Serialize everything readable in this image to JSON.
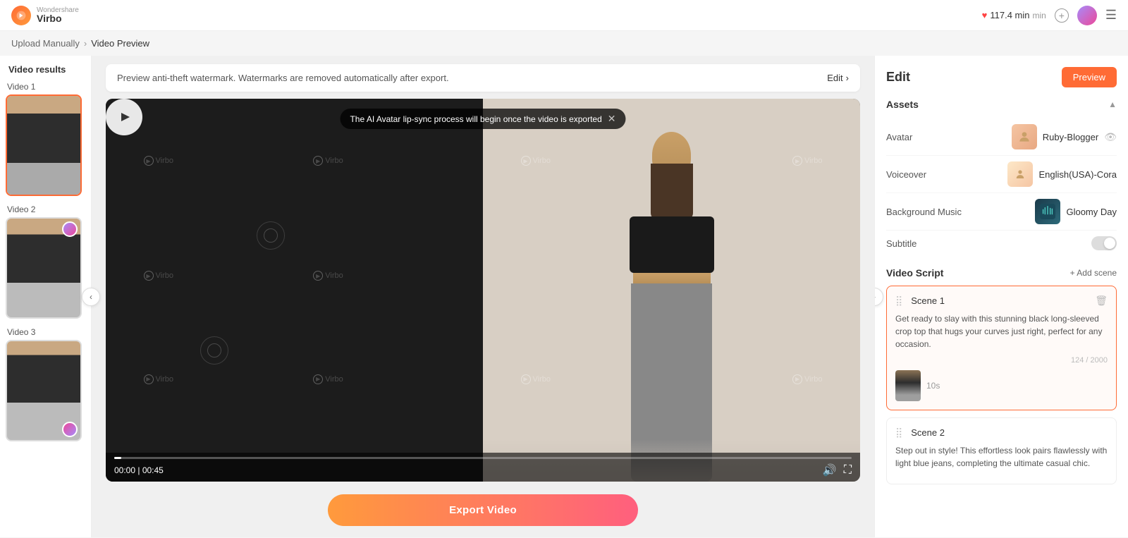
{
  "app": {
    "name": "Wondershare",
    "product": "Virbo",
    "credits": "117.4 min"
  },
  "breadcrumb": {
    "parent": "Upload Manually",
    "current": "Video Preview"
  },
  "sidebar": {
    "title": "Video results",
    "videos": [
      {
        "label": "Video 1",
        "active": true
      },
      {
        "label": "Video 2",
        "active": false
      },
      {
        "label": "Video 3",
        "active": false
      }
    ]
  },
  "watermark_notice": "Preview anti-theft watermark. Watermarks are removed automatically after export.",
  "edit_label": "Edit",
  "tooltip": "The AI Avatar lip-sync process will begin once the video is exported",
  "player": {
    "current_time": "00:00",
    "total_time": "00:45"
  },
  "export_btn": "Export Video",
  "panel": {
    "title": "Edit",
    "preview_btn": "Preview",
    "assets_title": "Assets",
    "avatar_label": "Avatar",
    "avatar_name": "Ruby-Blogger",
    "voiceover_label": "Voiceover",
    "voiceover_name": "English(USA)-Cora",
    "music_label": "Background Music",
    "music_name": "Gloomy Day",
    "subtitle_label": "Subtitle",
    "script_title": "Video Script",
    "add_scene": "+ Add scene",
    "scene1_label": "Scene 1",
    "scene1_text": "Get ready to slay with this stunning black long-sleeved crop top that hugs your curves just right, perfect for any occasion.",
    "scene1_count": "124 / 2000",
    "scene1_duration": "10s",
    "scene2_label": "Scene 2",
    "scene2_text": "Step out in style! This effortless look pairs flawlessly with light blue jeans, completing the ultimate casual chic."
  }
}
